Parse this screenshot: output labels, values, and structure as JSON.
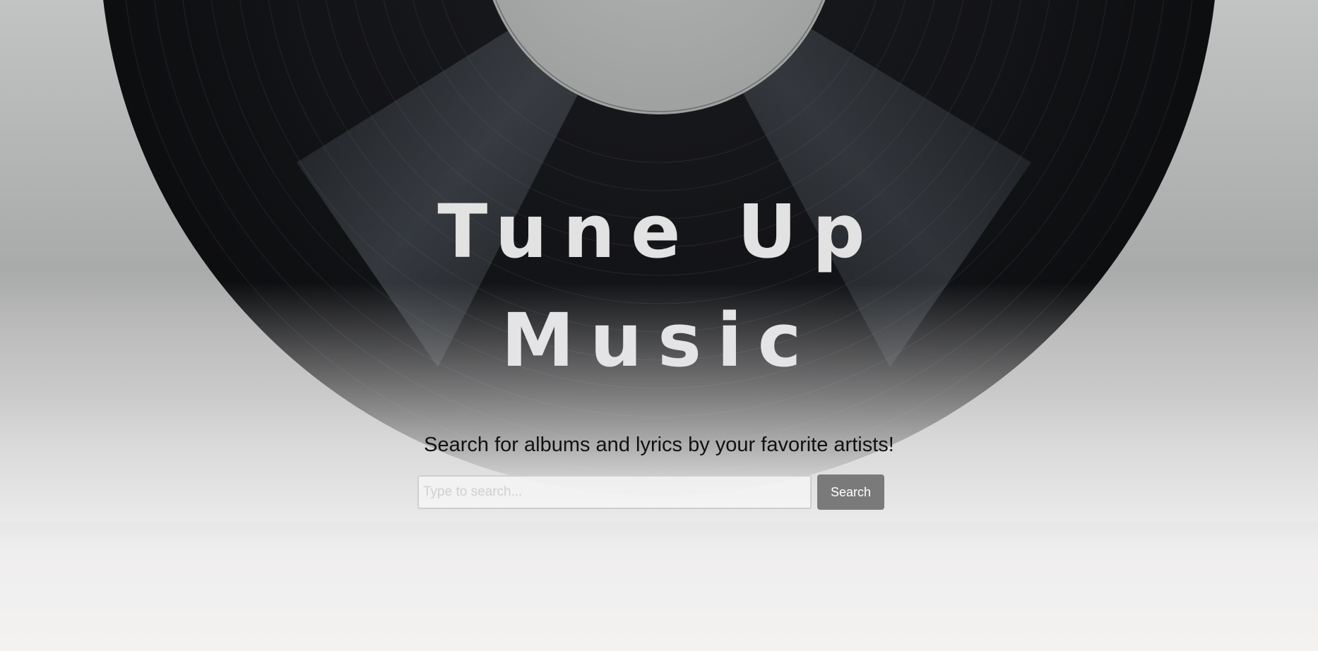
{
  "hero": {
    "title_line1": "Tune Up",
    "title_line2": "Music",
    "tagline": "Search for albums and lyrics by your favorite artists!"
  },
  "search": {
    "placeholder": "Type to search...",
    "value": "",
    "button_label": "Search"
  },
  "colors": {
    "record": "#111214",
    "label": "#a9abaa",
    "title_text": "#e2e2e3",
    "button_bg": "#7a7a7a",
    "button_text": "#ffffff"
  },
  "images": {
    "background": "vinyl-record-image"
  }
}
